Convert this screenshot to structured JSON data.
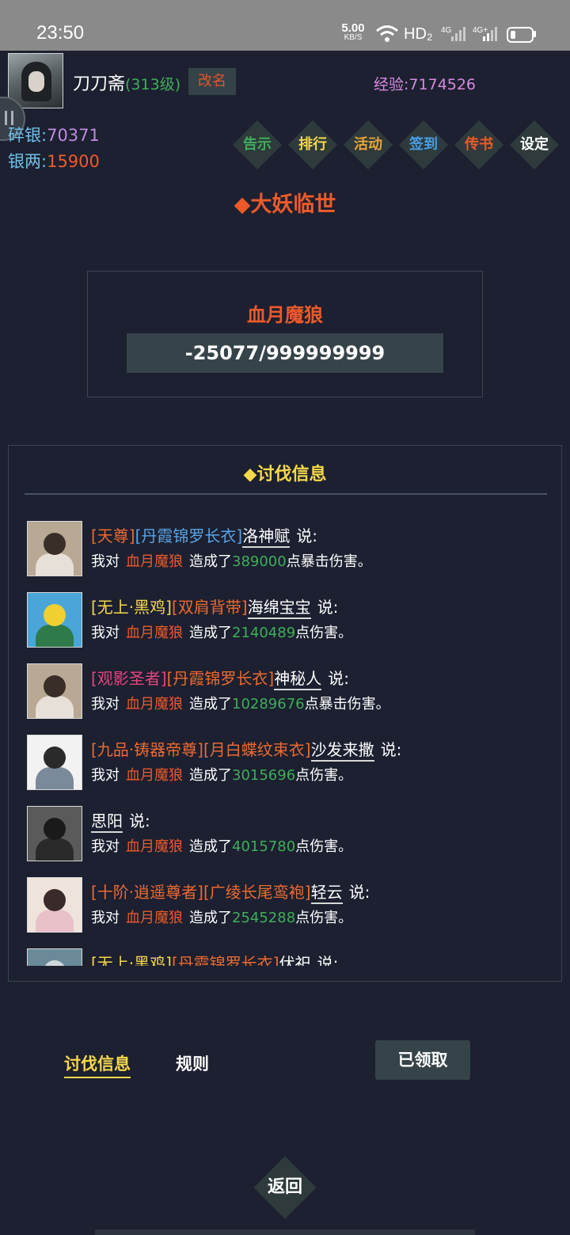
{
  "status_bar": {
    "time": "23:50",
    "net_speed_value": "5.00",
    "net_speed_unit": "KB/S",
    "hd_label": "HD₂",
    "signal_1": "4G",
    "signal_2": "4G+"
  },
  "player": {
    "name": "刀刀斋",
    "level": "(313级)",
    "rename_label": "改名",
    "exp_label": "经验:",
    "exp_value": "7174526",
    "gold_label": "碎银:",
    "gold_value": "70371",
    "silver_label": "银两:",
    "silver_value": "15900"
  },
  "menu": [
    {
      "label": "告示",
      "color": "#3fae5a"
    },
    {
      "label": "排行",
      "color": "#f6d84a"
    },
    {
      "label": "活动",
      "color": "#e8a438"
    },
    {
      "label": "签到",
      "color": "#4a9ee6"
    },
    {
      "label": "传书",
      "color": "#ec5a2a"
    },
    {
      "label": "设定",
      "color": "#ffffff"
    }
  ],
  "event": {
    "title": "◆大妖临世",
    "boss_name": "血月魔狼",
    "boss_hp": "-25077/999999999"
  },
  "info": {
    "title": "◆讨伐信息",
    "attack_prefix": "我对",
    "attack_verb": "造成了",
    "say": "说:",
    "entries": [
      {
        "tags": [
          {
            "text": "[天尊]",
            "color": "#ec6a30"
          },
          {
            "text": "[丹霞锦罗长衣]",
            "color": "#5aa4e6"
          }
        ],
        "name": "洛神赋",
        "boss": "血月魔狼",
        "damage": "389000",
        "suffix": "点暴击伤害。",
        "avatar": {
          "bg": "#b8a894",
          "head": "#3a2e28",
          "body": "#e6e0d8"
        }
      },
      {
        "tags": [
          {
            "text": "[无上·黑鸡]",
            "color": "#f6d84a"
          },
          {
            "text": "[双肩背带]",
            "color": "#ec6a30"
          }
        ],
        "name": "海绵宝宝",
        "boss": "血月魔狼",
        "damage": "2140489",
        "suffix": "点伤害。",
        "avatar": {
          "bg": "#4aa6d8",
          "head": "#f0d030",
          "body": "#2e7a4a"
        }
      },
      {
        "tags": [
          {
            "text": "[观影圣者]",
            "color": "#e6447e"
          },
          {
            "text": "[丹霞锦罗长衣]",
            "color": "#ec6a30"
          }
        ],
        "name": "神秘人",
        "boss": "血月魔狼",
        "damage": "10289676",
        "suffix": "点暴击伤害。",
        "avatar": {
          "bg": "#b8a894",
          "head": "#3a2e28",
          "body": "#e6e0d8"
        }
      },
      {
        "tags": [
          {
            "text": "[九品·铸器帝尊]",
            "color": "#ec6a30"
          },
          {
            "text": "[月白蝶纹束衣]",
            "color": "#ec6a30"
          }
        ],
        "name": "沙发来撒",
        "boss": "血月魔狼",
        "damage": "3015696",
        "suffix": "点伤害。",
        "avatar": {
          "bg": "#f2f2f2",
          "head": "#2a2a2a",
          "body": "#7a8a9a"
        }
      },
      {
        "tags": [],
        "name": "思阳",
        "boss": "血月魔狼",
        "damage": "4015780",
        "suffix": "点伤害。",
        "avatar": {
          "bg": "#5a5a5a",
          "head": "#1a1a1a",
          "body": "#2a2a2a"
        }
      },
      {
        "tags": [
          {
            "text": "[十阶·逍遥尊者]",
            "color": "#ec6a30"
          },
          {
            "text": "[广绫长尾鸾袍]",
            "color": "#ec6a30"
          }
        ],
        "name": "轻云",
        "boss": "血月魔狼",
        "damage": "2545288",
        "suffix": "点伤害。",
        "avatar": {
          "bg": "#efe4dc",
          "head": "#3a2a2a",
          "body": "#e8c0c8"
        }
      },
      {
        "tags": [
          {
            "text": "[无上·黑鸡]",
            "color": "#f6d84a"
          },
          {
            "text": "[丹霞锦罗长衣]",
            "color": "#ec6a30"
          }
        ],
        "name": "伏祀",
        "boss": "血月魔狼",
        "damage": "",
        "suffix": "",
        "avatar": {
          "bg": "#6a8a9a",
          "head": "#d0d8dc",
          "body": "#4a6a7a"
        }
      }
    ]
  },
  "tabs": {
    "info_label": "讨伐信息",
    "rules_label": "规则",
    "claimed_label": "已领取"
  },
  "back_label": "返回"
}
